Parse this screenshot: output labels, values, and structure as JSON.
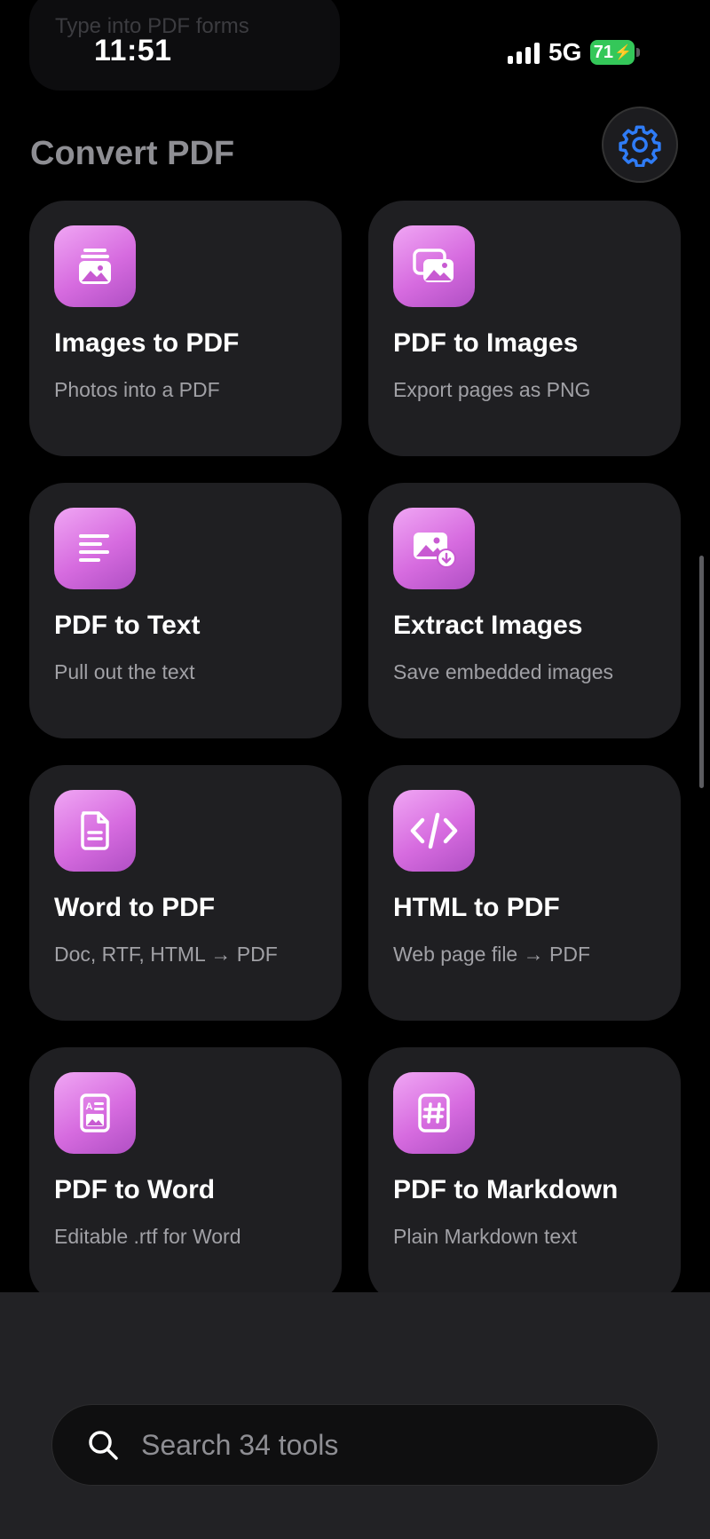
{
  "previous_card": {
    "subtitle": "Type into PDF forms"
  },
  "status_bar": {
    "time": "11:51",
    "network": "5G",
    "battery": "71"
  },
  "section": {
    "title": "Convert PDF"
  },
  "cards": [
    {
      "title": "Images to PDF",
      "subtitle": "Photos into a PDF",
      "icon": "images-stack-icon"
    },
    {
      "title": "PDF to Images",
      "subtitle": "Export pages as PNG",
      "icon": "photo-stack-icon"
    },
    {
      "title": "PDF to Text",
      "subtitle": "Pull out the text",
      "icon": "text-lines-icon"
    },
    {
      "title": "Extract Images",
      "subtitle": "Save embedded images",
      "icon": "image-download-icon"
    },
    {
      "title": "Word to PDF",
      "subtitle": "Doc, RTF, HTML → PDF",
      "icon": "document-icon"
    },
    {
      "title": "HTML to PDF",
      "subtitle": "Web page file → PDF",
      "icon": "code-brackets-icon"
    },
    {
      "title": "PDF to Word",
      "subtitle": "Editable .rtf for Word",
      "icon": "text-image-doc-icon"
    },
    {
      "title": "PDF to Markdown",
      "subtitle": "Plain Markdown text",
      "icon": "hashtag-icon"
    }
  ],
  "search": {
    "placeholder": "Search 34 tools"
  },
  "colors": {
    "accent": "#2f7cf6",
    "card_bg": "#1f1f22",
    "icon_gradient_start": "#f0a6f4",
    "icon_gradient_end": "#b04fc4"
  }
}
